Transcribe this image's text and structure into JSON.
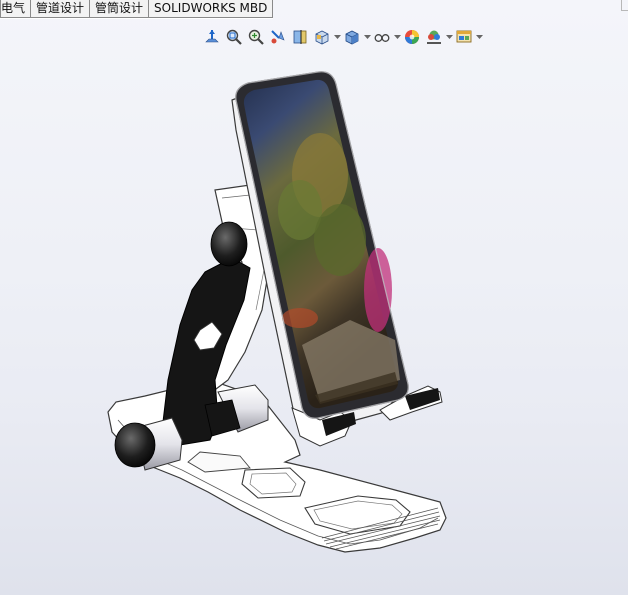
{
  "tabs": [
    {
      "label": "电气"
    },
    {
      "label": "管道设计"
    },
    {
      "label": "管筒设计"
    },
    {
      "label": "SOLIDWORKS MBD"
    }
  ],
  "toolbar": [
    {
      "icon": "view-orientation-icon"
    },
    {
      "icon": "zoom-to-fit-icon"
    },
    {
      "icon": "zoom-to-area-icon"
    },
    {
      "icon": "previous-view-icon"
    },
    {
      "icon": "section-view-icon"
    },
    {
      "icon": "view-selector-icon",
      "dropdown": true
    },
    {
      "icon": "display-style-icon",
      "dropdown": true
    },
    {
      "icon": "hide-show-items-icon",
      "dropdown": true
    },
    {
      "icon": "edit-appearance-icon"
    },
    {
      "icon": "apply-scene-icon",
      "dropdown": true
    },
    {
      "icon": "view-settings-icon",
      "dropdown": true
    }
  ],
  "model": {
    "name": "phone-stand-assembly"
  },
  "colors": {
    "accent": "#1e66c8",
    "background": "#eef0f6"
  }
}
